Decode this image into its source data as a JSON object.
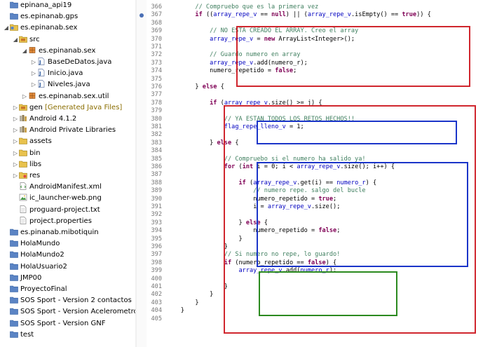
{
  "explorer": {
    "items": [
      {
        "id": "epinana-api19",
        "label": "epinana_api19",
        "depth": 0,
        "twisty": "",
        "icon": "folder"
      },
      {
        "id": "epinanab-gps",
        "label": "es.epinanab.gps",
        "depth": 0,
        "twisty": "",
        "icon": "folder"
      },
      {
        "id": "epinanab-sex",
        "label": "es.epinanab.sex",
        "depth": 0,
        "twisty": "open",
        "icon": "project"
      },
      {
        "id": "src",
        "label": "src",
        "depth": 1,
        "twisty": "open",
        "icon": "src"
      },
      {
        "id": "pkg-sex",
        "label": "es.epinanab.sex",
        "depth": 2,
        "twisty": "open",
        "icon": "package"
      },
      {
        "id": "basededatos",
        "label": "BaseDeDatos.java",
        "depth": 3,
        "twisty": "closed",
        "icon": "java"
      },
      {
        "id": "inicio",
        "label": "Inicio.java",
        "depth": 3,
        "twisty": "closed",
        "icon": "java"
      },
      {
        "id": "niveles",
        "label": "Niveles.java",
        "depth": 3,
        "twisty": "closed",
        "icon": "java"
      },
      {
        "id": "pkg-util",
        "label": "es.epinanab.sex.util",
        "depth": 2,
        "twisty": "closed",
        "icon": "package"
      },
      {
        "id": "gen",
        "label": "gen",
        "decorator": "[Generated Java Files]",
        "depth": 1,
        "twisty": "closed",
        "icon": "src"
      },
      {
        "id": "android-412",
        "label": "Android 4.1.2",
        "depth": 1,
        "twisty": "closed",
        "icon": "library"
      },
      {
        "id": "android-private",
        "label": "Android Private Libraries",
        "depth": 1,
        "twisty": "closed",
        "icon": "library"
      },
      {
        "id": "assets",
        "label": "assets",
        "depth": 1,
        "twisty": "closed",
        "icon": "folder-open"
      },
      {
        "id": "bin",
        "label": "bin",
        "depth": 1,
        "twisty": "closed",
        "icon": "folder-open"
      },
      {
        "id": "libs",
        "label": "libs",
        "depth": 1,
        "twisty": "closed",
        "icon": "folder-open"
      },
      {
        "id": "res",
        "label": "res",
        "depth": 1,
        "twisty": "closed",
        "icon": "res"
      },
      {
        "id": "manifest",
        "label": "AndroidManifest.xml",
        "depth": 1,
        "twisty": "",
        "icon": "xml"
      },
      {
        "id": "ic-launcher",
        "label": "ic_launcher-web.png",
        "depth": 1,
        "twisty": "",
        "icon": "image"
      },
      {
        "id": "proguard",
        "label": "proguard-project.txt",
        "depth": 1,
        "twisty": "",
        "icon": "file"
      },
      {
        "id": "project-props",
        "label": "project.properties",
        "depth": 1,
        "twisty": "",
        "icon": "file"
      },
      {
        "id": "mibotiquin",
        "label": "es.pinanab.mibotiquin",
        "depth": 0,
        "twisty": "",
        "icon": "folder"
      },
      {
        "id": "holamundo",
        "label": "HolaMundo",
        "depth": 0,
        "twisty": "",
        "icon": "folder"
      },
      {
        "id": "holamundo2",
        "label": "HolaMundo2",
        "depth": 0,
        "twisty": "",
        "icon": "folder"
      },
      {
        "id": "holausuario2",
        "label": "HolaUsuario2",
        "depth": 0,
        "twisty": "",
        "icon": "folder"
      },
      {
        "id": "jmp00",
        "label": "JMP00",
        "depth": 0,
        "twisty": "",
        "icon": "folder"
      },
      {
        "id": "proyectofinal",
        "label": "ProyectoFinal",
        "depth": 0,
        "twisty": "",
        "icon": "folder"
      },
      {
        "id": "sos-v2",
        "label": "SOS Sport - Version 2 contactos",
        "depth": 0,
        "twisty": "",
        "icon": "folder"
      },
      {
        "id": "sos-acel",
        "label": "SOS Sport - Version Acelerometro",
        "depth": 0,
        "twisty": "",
        "icon": "folder"
      },
      {
        "id": "sos-gnf",
        "label": "SOS Sport - Version GNF",
        "depth": 0,
        "twisty": "",
        "icon": "folder"
      },
      {
        "id": "test",
        "label": "test",
        "depth": 0,
        "twisty": "",
        "icon": "folder"
      }
    ]
  },
  "editor": {
    "breakpoint_line": 367,
    "lines": [
      {
        "n": "366",
        "indent": 8,
        "tokens": [
          [
            "cm",
            "// Compruebo que es la primera vez"
          ]
        ]
      },
      {
        "n": "367",
        "indent": 8,
        "tokens": [
          [
            "kw",
            "if"
          ],
          [
            "",
            " (("
          ],
          [
            "vr",
            "array_repe_v"
          ],
          [
            "",
            " == "
          ],
          [
            "kw",
            "null"
          ],
          [
            "",
            ") || ("
          ],
          [
            "vr",
            "array_repe_v"
          ],
          [
            "",
            ".isEmpty() == "
          ],
          [
            "kw",
            "true"
          ],
          [
            "",
            ")) {"
          ]
        ]
      },
      {
        "n": "368",
        "indent": 0,
        "tokens": []
      },
      {
        "n": "369",
        "indent": 12,
        "tokens": [
          [
            "cm",
            "// NO ESTA CREADO EL ARRAY. Creo el array"
          ]
        ]
      },
      {
        "n": "370",
        "indent": 12,
        "tokens": [
          [
            "vr",
            "array_repe_v"
          ],
          [
            "",
            " = "
          ],
          [
            "kw",
            "new"
          ],
          [
            "",
            " ArrayList<Integer>();"
          ]
        ]
      },
      {
        "n": "371",
        "indent": 0,
        "tokens": []
      },
      {
        "n": "372",
        "indent": 12,
        "tokens": [
          [
            "cm",
            "// Guardo numero en array"
          ]
        ]
      },
      {
        "n": "373",
        "indent": 12,
        "tokens": [
          [
            "vr",
            "array_repe_v"
          ],
          [
            "",
            ".add(numero_r);"
          ]
        ]
      },
      {
        "n": "374",
        "indent": 12,
        "tokens": [
          [
            "",
            "numero_repetido = "
          ],
          [
            "kw",
            "false"
          ],
          [
            "",
            ";"
          ]
        ]
      },
      {
        "n": "375",
        "indent": 0,
        "tokens": []
      },
      {
        "n": "376",
        "indent": 8,
        "tokens": [
          [
            "",
            "} "
          ],
          [
            "kw",
            "else"
          ],
          [
            "",
            " {"
          ]
        ]
      },
      {
        "n": "377",
        "indent": 0,
        "tokens": []
      },
      {
        "n": "378",
        "indent": 12,
        "tokens": [
          [
            "kw",
            "if"
          ],
          [
            "",
            " ("
          ],
          [
            "vr",
            "array_repe_v"
          ],
          [
            "",
            ".size() >= j) {"
          ]
        ]
      },
      {
        "n": "379",
        "indent": 0,
        "tokens": []
      },
      {
        "n": "380",
        "indent": 16,
        "tokens": [
          [
            "cm",
            "// YA ESTAN TODOS LOS RETOS HECHOS!!"
          ]
        ]
      },
      {
        "n": "381",
        "indent": 16,
        "tokens": [
          [
            "vr",
            "flag_repe_lleno_v"
          ],
          [
            "",
            " = 1;"
          ]
        ]
      },
      {
        "n": "382",
        "indent": 0,
        "tokens": []
      },
      {
        "n": "383",
        "indent": 12,
        "tokens": [
          [
            "",
            "} "
          ],
          [
            "kw",
            "else"
          ],
          [
            "",
            " {"
          ]
        ]
      },
      {
        "n": "384",
        "indent": 0,
        "tokens": []
      },
      {
        "n": "385",
        "indent": 16,
        "tokens": [
          [
            "cm",
            "// Compruebo si el numero ha salido ya!"
          ]
        ]
      },
      {
        "n": "386",
        "indent": 16,
        "tokens": [
          [
            "kw",
            "for"
          ],
          [
            "",
            " ("
          ],
          [
            "kw",
            "int"
          ],
          [
            "",
            " i = 0; i < "
          ],
          [
            "vr",
            "array_repe_v"
          ],
          [
            "",
            ".size(); i++) {"
          ]
        ]
      },
      {
        "n": "387",
        "indent": 0,
        "tokens": []
      },
      {
        "n": "388",
        "indent": 20,
        "tokens": [
          [
            "kw",
            "if"
          ],
          [
            "",
            " ("
          ],
          [
            "vr",
            "array_repe_v"
          ],
          [
            "",
            ".get(i) == "
          ],
          [
            "vr",
            "numero_r"
          ],
          [
            "",
            ") {"
          ]
        ]
      },
      {
        "n": "389",
        "indent": 24,
        "tokens": [
          [
            "cm",
            "// numero repe. salgo del bucle"
          ]
        ]
      },
      {
        "n": "390",
        "indent": 24,
        "tokens": [
          [
            "",
            "numero_repetido = "
          ],
          [
            "kw",
            "true"
          ],
          [
            "",
            ";"
          ]
        ]
      },
      {
        "n": "391",
        "indent": 24,
        "tokens": [
          [
            "",
            "i = "
          ],
          [
            "vr",
            "array_repe_v"
          ],
          [
            "",
            ".size();"
          ]
        ]
      },
      {
        "n": "392",
        "indent": 0,
        "tokens": []
      },
      {
        "n": "393",
        "indent": 20,
        "tokens": [
          [
            "",
            "} "
          ],
          [
            "kw",
            "else"
          ],
          [
            "",
            " {"
          ]
        ]
      },
      {
        "n": "394",
        "indent": 24,
        "tokens": [
          [
            "",
            "numero_repetido = "
          ],
          [
            "kw",
            "false"
          ],
          [
            "",
            ";"
          ]
        ]
      },
      {
        "n": "395",
        "indent": 20,
        "tokens": [
          [
            "",
            "}"
          ]
        ]
      },
      {
        "n": "396",
        "indent": 16,
        "tokens": [
          [
            "",
            "}"
          ]
        ]
      },
      {
        "n": "397",
        "indent": 16,
        "tokens": [
          [
            "cm",
            "// Si numero no repe, lo guardo!"
          ]
        ]
      },
      {
        "n": "398",
        "indent": 16,
        "tokens": [
          [
            "kw",
            "if"
          ],
          [
            "",
            " (numero_repetido == "
          ],
          [
            "kw",
            "false"
          ],
          [
            "",
            ") {"
          ]
        ]
      },
      {
        "n": "399",
        "indent": 20,
        "tokens": [
          [
            "vr",
            "array_repe_v"
          ],
          [
            "",
            ".add("
          ],
          [
            "vr",
            "numero_r"
          ],
          [
            "",
            ");"
          ]
        ]
      },
      {
        "n": "400",
        "indent": 0,
        "tokens": []
      },
      {
        "n": "401",
        "indent": 16,
        "tokens": [
          [
            "",
            "}"
          ]
        ]
      },
      {
        "n": "402",
        "indent": 12,
        "tokens": [
          [
            "",
            "}"
          ]
        ]
      },
      {
        "n": "403",
        "indent": 8,
        "tokens": [
          [
            "",
            "}"
          ]
        ]
      },
      {
        "n": "404",
        "indent": 4,
        "tokens": [
          [
            "",
            "}"
          ]
        ]
      },
      {
        "n": "405",
        "indent": 0,
        "tokens": []
      }
    ]
  },
  "colors": {
    "keyword": "#7f0055",
    "comment": "#3f7f5f",
    "field": "#0000c0",
    "annotation_red": "#d0262e",
    "annotation_blue": "#1b35c9",
    "annotation_green": "#2b8a1f"
  }
}
